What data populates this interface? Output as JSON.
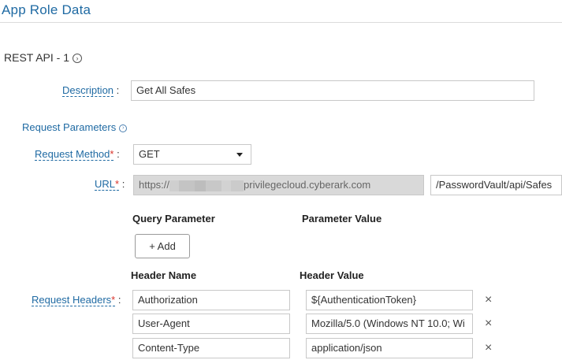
{
  "page": {
    "title": "App Role Data"
  },
  "rest_api": {
    "title": "REST API - 1"
  },
  "description": {
    "label": "Description",
    "colon": ":",
    "value": "Get All Safes"
  },
  "request_parameters": {
    "label": "Request Parameters"
  },
  "request_method": {
    "label": "Request Method",
    "required": "*",
    "colon": ":",
    "value": "GET"
  },
  "url": {
    "label": "URL",
    "required": "*",
    "colon": ":",
    "base_prefix": "https://",
    "base_suffix": "privilegecloud.cyberark.com",
    "path": "/PasswordVault/api/Safes"
  },
  "query": {
    "param_header": "Query Parameter",
    "value_header": "Parameter Value",
    "add_label": "+ Add"
  },
  "headers": {
    "label": "Request Headers",
    "required": "*",
    "colon": ":",
    "name_header": "Header Name",
    "value_header": "Header Value",
    "rows": [
      {
        "name": "Authorization",
        "value": "${AuthenticationToken}"
      },
      {
        "name": "User-Agent",
        "value": "Mozilla/5.0 (Windows NT 10.0; Wi"
      },
      {
        "name": "Content-Type",
        "value": "application/json"
      }
    ],
    "remove_icon": "×"
  },
  "icons": {
    "expand": "circle-chevron-right-icon",
    "remove": "close-icon"
  },
  "colors": {
    "accent": "#1f6aa3",
    "required": "#d9342b",
    "disabled_bg": "#d9d9d9"
  }
}
